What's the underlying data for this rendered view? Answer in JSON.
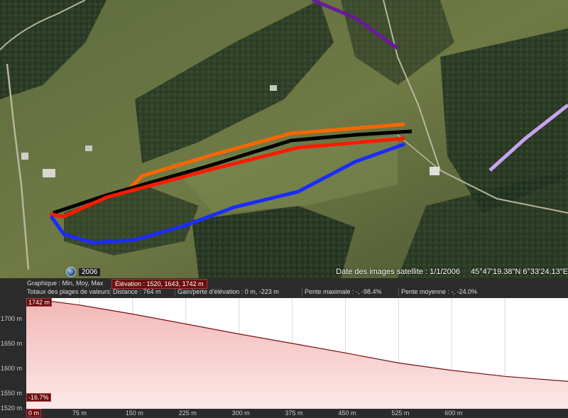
{
  "map": {
    "year": "2006",
    "image_date_label": "Date des images satellite : 1/1/2006",
    "coordinates": "45°47'19.38\"N    6°33'24.13\"E",
    "route_colors": {
      "black": "#000000",
      "orange": "#ff6600",
      "red": "#ff1a00",
      "blue": "#1a2cff",
      "purple": "#6a1a9a",
      "lavender": "#c9a2f0"
    }
  },
  "profile": {
    "graph_label": "Graphique : Min, Moy, Max",
    "elevation_label": "Élévation : 1520, 1643, 1742 m",
    "totals_label": "Totaux des plages de valeurs",
    "distance": "Distance : 764 m",
    "elev_gain": "Gain/perte d'élévation : 0 m, -223 m",
    "max_slope": "Pente maximale : -, -98.4%",
    "avg_slope": "Pente moyenne : -, -24.0%",
    "top_tag": "1742 m",
    "bottom_tag": "-16.7%",
    "start_tag": "0 m",
    "y_labels": [
      "1742 m",
      "1700 m",
      "1650 m",
      "1600 m",
      "1550 m",
      "1520 m"
    ],
    "x_labels": [
      "75 m",
      "150 m",
      "225 m",
      "300 m",
      "375 m",
      "450 m",
      "525 m",
      "600 m"
    ]
  },
  "chart_data": {
    "type": "area",
    "xlabel": "",
    "ylabel": "",
    "ylim": [
      1520,
      1742
    ],
    "xlim": [
      0,
      764
    ],
    "series": [
      {
        "x": [
          0,
          75,
          150,
          225,
          300,
          375,
          450,
          525,
          600,
          675,
          764
        ],
        "values": [
          1742,
          1728,
          1710,
          1690,
          1670,
          1651,
          1632,
          1612,
          1597,
          1585,
          1575
        ]
      }
    ]
  }
}
